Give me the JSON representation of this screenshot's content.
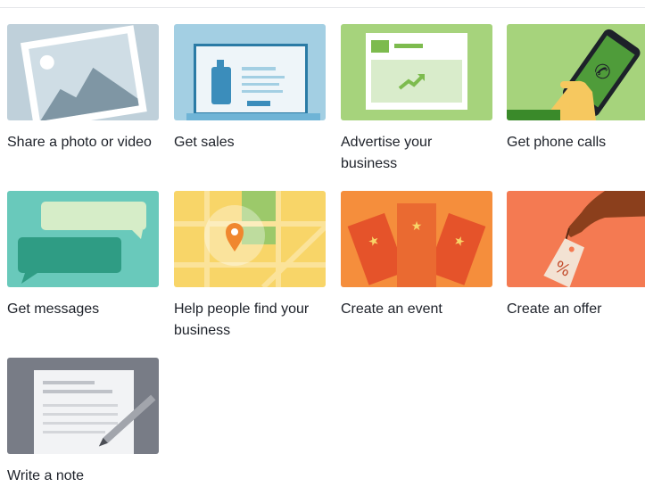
{
  "tiles": [
    {
      "label": "Share a photo or video",
      "icon": "photo-icon",
      "color": "#bfd0da"
    },
    {
      "label": "Get sales",
      "icon": "storefront-bottle-icon",
      "color": "#a3cfe3"
    },
    {
      "label": "Advertise your business",
      "icon": "webpage-trend-icon",
      "color": "#a6d37c"
    },
    {
      "label": "Get phone calls",
      "icon": "phone-in-hand-icon",
      "color": "#a6d37c"
    },
    {
      "label": "Get messages",
      "icon": "chat-bubbles-icon",
      "color": "#69c9bb"
    },
    {
      "label": "Help people find your business",
      "icon": "map-pin-icon",
      "color": "#f8d568"
    },
    {
      "label": "Create an event",
      "icon": "event-tickets-icon",
      "color": "#f58e3c"
    },
    {
      "label": "Create an offer",
      "icon": "price-tag-icon",
      "color": "#f47a52"
    },
    {
      "label": "Write a note",
      "icon": "note-pencil-icon",
      "color": "#787c86"
    }
  ]
}
